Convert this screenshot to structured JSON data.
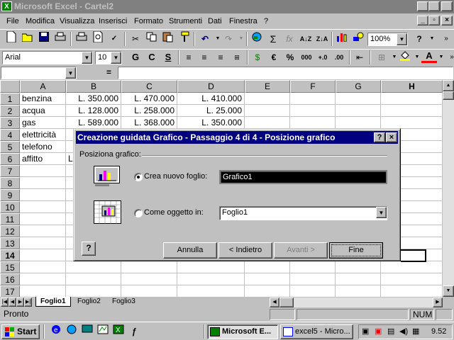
{
  "window": {
    "title": "Microsoft Excel - Cartel2",
    "icon": "excel-icon"
  },
  "menu": [
    "File",
    "Modifica",
    "Visualizza",
    "Inserisci",
    "Formato",
    "Strumenti",
    "Dati",
    "Finestra",
    "?"
  ],
  "toolbar": {
    "zoom": "100%",
    "font": "Arial",
    "font_size": "10",
    "bold": "G",
    "italic": "C",
    "underline": "S",
    "currency": "€",
    "percent": "%",
    "thousands": "000",
    "autosum": "Σ",
    "function": "fx",
    "help": "?"
  },
  "formula_bar": {
    "name_box": "",
    "equals": "=",
    "formula": ""
  },
  "grid": {
    "columns": [
      "A",
      "B",
      "C",
      "D",
      "E",
      "F",
      "G",
      "H"
    ],
    "rows": [
      "1",
      "2",
      "3",
      "4",
      "5",
      "6",
      "7",
      "8",
      "9",
      "10",
      "11",
      "12",
      "13",
      "14",
      "15",
      "16",
      "17"
    ],
    "data": [
      [
        "benzina",
        "L. 350.000",
        "L. 470.000",
        "L. 410.000"
      ],
      [
        "acqua",
        "L. 128.000",
        "L. 258.000",
        "L. 25.000"
      ],
      [
        "gas",
        "L. 589.000",
        "L. 368.000",
        "L. 350.000"
      ],
      [
        "elettricità",
        "",
        "",
        ""
      ],
      [
        "telefono",
        "",
        "",
        ""
      ],
      [
        "affitto",
        "L",
        "",
        ""
      ]
    ]
  },
  "sheets": [
    "Foglio1",
    "Foglio2",
    "Foglio3"
  ],
  "status": {
    "text": "Pronto",
    "num": "NUM"
  },
  "taskbar": {
    "start": "Start",
    "tasks": [
      "Microsoft E...",
      "excel5 - Micro..."
    ],
    "clock": "9.52"
  },
  "dialog": {
    "title": "Creazione guidata Grafico - Passaggio 4 di 4 - Posizione grafico",
    "group_label": "Posiziona grafico:",
    "option_new_sheet": "Crea nuovo foglio:",
    "new_sheet_value": "Grafico1",
    "option_object": "Come oggetto in:",
    "object_value": "Foglio1",
    "buttons": {
      "cancel": "Annulla",
      "back": "< Indietro",
      "next": "Avanti >",
      "finish": "Fine"
    }
  },
  "colors": {
    "dialog_title_bg": "#000080",
    "face": "#c0c0c0",
    "inactive_title": "#808080"
  }
}
